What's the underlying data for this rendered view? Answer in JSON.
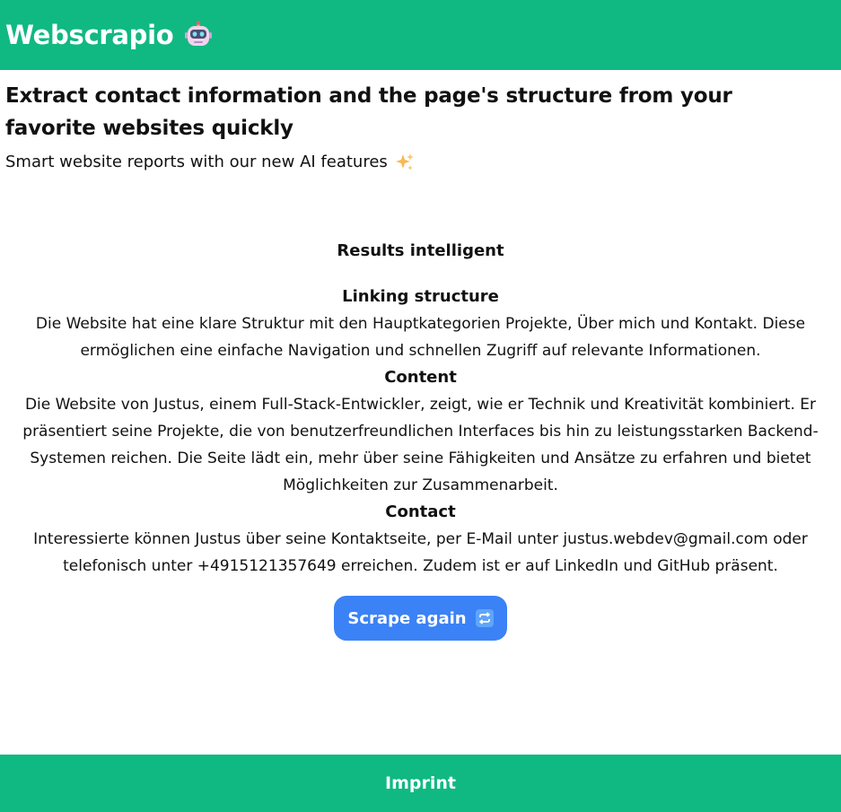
{
  "header": {
    "title": "Webscrapio",
    "icon": "robot-icon"
  },
  "hero": {
    "title": "Extract contact information and the page's structure from your favorite websites quickly",
    "subtitle": "Smart website reports with our new AI features",
    "subtitle_icon": "sparkles-icon"
  },
  "results": {
    "heading": "Results intelligent",
    "sections": [
      {
        "heading": "Linking structure",
        "text": "Die Website hat eine klare Struktur mit den Hauptkategorien Projekte, Über mich und Kontakt. Diese ermöglichen eine einfache Navigation und schnellen Zugriff auf relevante Informationen."
      },
      {
        "heading": "Content",
        "text": "Die Website von Justus, einem Full-Stack-Entwickler, zeigt, wie er Technik und Kreativität kombiniert. Er präsentiert seine Projekte, die von benutzerfreundlichen Interfaces bis hin zu leistungsstarken Backend-Systemen reichen. Die Seite lädt ein, mehr über seine Fähigkeiten und Ansätze zu erfahren und bietet Möglichkeiten zur Zusammenarbeit."
      },
      {
        "heading": "Contact",
        "text": "Interessierte können Justus über seine Kontaktseite, per E-Mail unter justus.webdev@gmail.com oder telefonisch unter +4915121357649 erreichen. Zudem ist er auf LinkedIn und GitHub präsent."
      }
    ]
  },
  "actions": {
    "scrape_again_label": "Scrape again",
    "scrape_again_icon": "repeat-icon"
  },
  "footer": {
    "imprint_label": "Imprint"
  },
  "colors": {
    "brand_green": "#10b981",
    "button_blue": "#3b82f6",
    "text": "#111111",
    "background": "#ffffff"
  }
}
